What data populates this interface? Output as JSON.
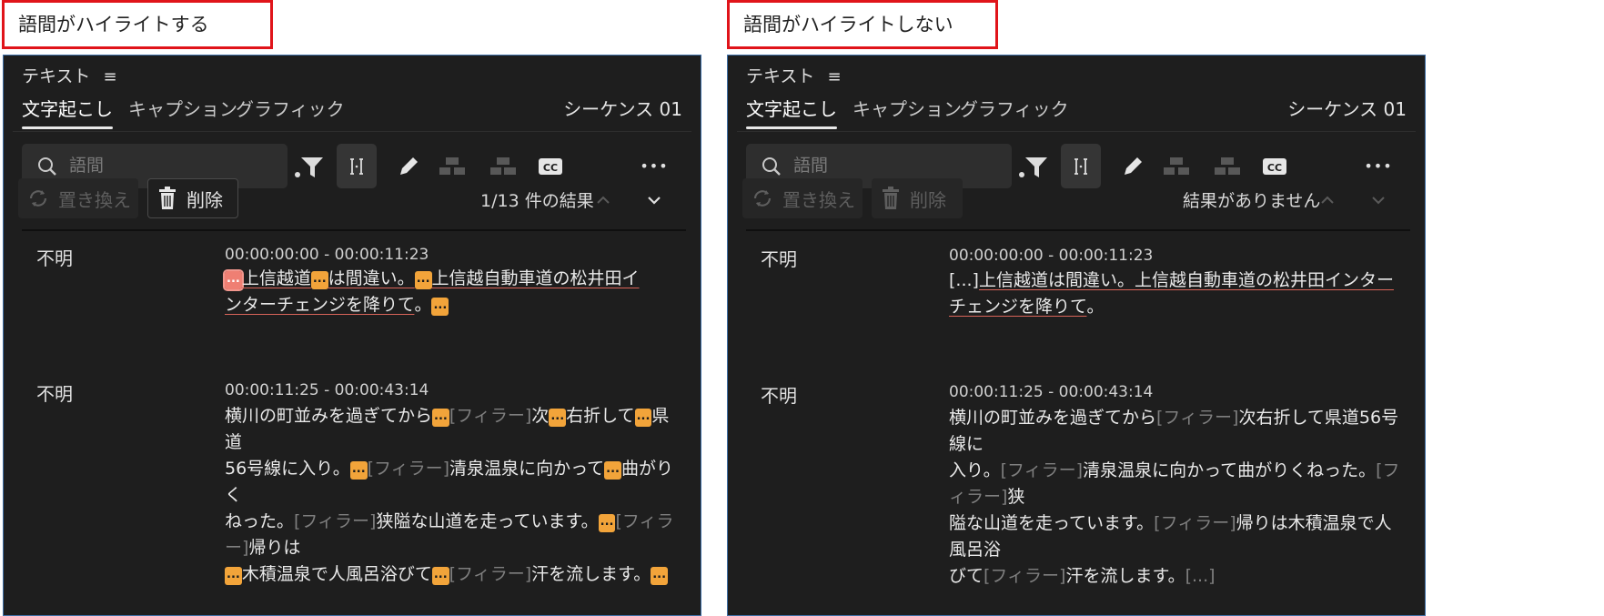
{
  "left": {
    "caption": "語間がハイライトする",
    "panel_title": "テキスト",
    "menu_icon": "≡",
    "tabs": [
      "文字起こし",
      "キャプション",
      "グラフィック"
    ],
    "sequence": "シーケンス 01",
    "search_placeholder": "語間",
    "replace_label": "置き換え",
    "delete_label": "削除",
    "result_text": "1/13 件の結果",
    "cc_label": "CC",
    "more": "•••",
    "entries": [
      {
        "speaker": "不明",
        "time": "00:00:00:00 - 00:00:11:23",
        "gap": "...",
        "t1": "上信越道",
        "t2": "は間違い。",
        "t3": "上信越自動車道の松井田イ",
        "t4": "ンターチェンジを降りて",
        "t5": "。"
      },
      {
        "speaker": "不明",
        "time": "00:00:11:25 - 00:00:43:14",
        "filler": "[フィラー]",
        "t1": "横川の町並みを過ぎてから",
        "t2": "次",
        "t3": "右折して",
        "t4": "県道",
        "t5": "56号線に入り。",
        "t6": "清泉温泉に向かって",
        "t7": "曲がりく",
        "t8": "ねった。",
        "t9": "狭隘な山道を走っています。",
        "t10": "帰りは",
        "t11": "木積温泉で人風呂浴びて",
        "t12": "汗を流します。"
      }
    ]
  },
  "right": {
    "caption": "語間がハイライトしない",
    "panel_title": "テキスト",
    "menu_icon": "≡",
    "tabs": [
      "文字起こし",
      "キャプション",
      "グラフィック"
    ],
    "sequence": "シーケンス 01",
    "search_placeholder": "語間",
    "replace_label": "置き換え",
    "delete_label": "削除",
    "result_text": "結果がありません",
    "cc_label": "CC",
    "more": "•••",
    "entries": [
      {
        "speaker": "不明",
        "time": "00:00:00:00 - 00:00:11:23",
        "pre": "[...]",
        "t1": "上信越道は間違い。上信越自動車道の松井田インター",
        "t2": "チェンジを降りて",
        "t3": "。"
      },
      {
        "speaker": "不明",
        "time": "00:00:11:25 - 00:00:43:14",
        "filler": "[フィラー]",
        "gap": "[...]",
        "t1": "横川の町並みを過ぎてから",
        "t2": "次右折して県道56号線に",
        "t3": "入り。",
        "t4": "清泉温泉に向かって曲がりくねった。",
        "t5": "狭",
        "t6": "隘な山道を走っています。",
        "t7": "帰りは木積温泉で人風呂浴",
        "t8": "びて",
        "t9": "汗を流します。"
      }
    ]
  },
  "colors": {
    "accent_gap": "#f2a43a",
    "selected_gap": "#ef7f73",
    "caption_border": "#e0141a",
    "panel_border": "#3f6fa6"
  }
}
